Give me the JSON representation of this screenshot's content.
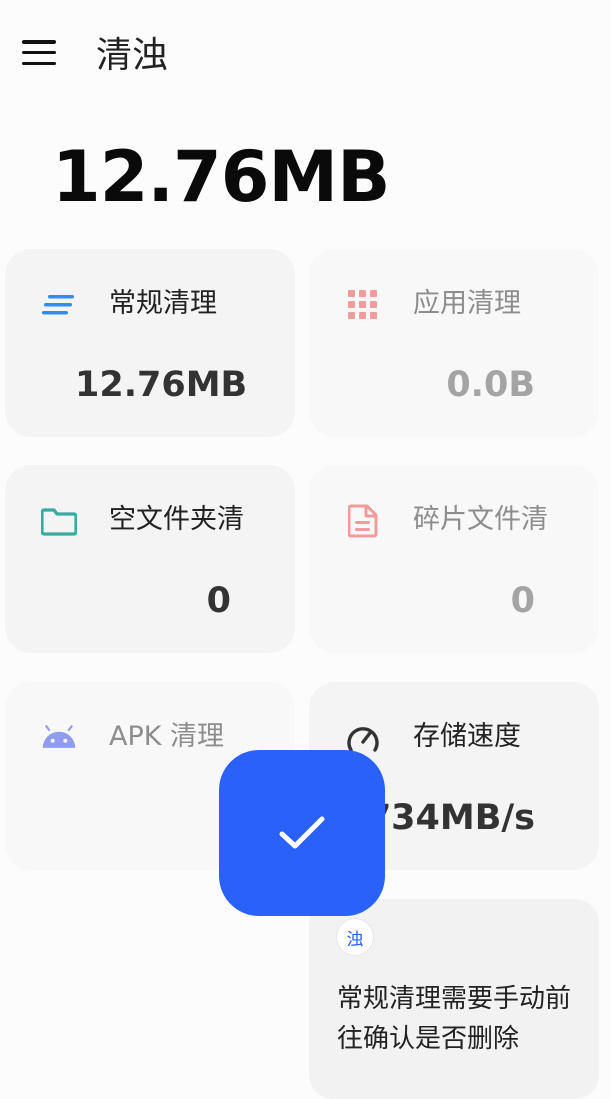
{
  "header": {
    "title": "清浊"
  },
  "summary": {
    "total_size": "12.76MB"
  },
  "cards": [
    {
      "id": "general",
      "label": "常规清理",
      "value": "12.76MB",
      "icon": "lines-icon",
      "icon_color": "#2f8cf0"
    },
    {
      "id": "app",
      "label": "应用清理",
      "value": "0.0B",
      "icon": "grid-icon",
      "icon_color": "#f19b9b"
    },
    {
      "id": "empty-folder",
      "label": "空文件夹清",
      "value": "0",
      "icon": "folder-icon",
      "icon_color": "#3aa99f"
    },
    {
      "id": "fragment",
      "label": "碎片文件清",
      "value": "0",
      "icon": "document-icon",
      "icon_color": "#f19b9b"
    },
    {
      "id": "apk",
      "label": "APK 清理",
      "value": "",
      "icon": "android-icon",
      "icon_color": "#8f9cf0"
    },
    {
      "id": "storage-speed",
      "label": "存储速度",
      "value": "734MB/s",
      "icon": "speedometer-icon",
      "icon_color": "#333333"
    }
  ],
  "fab": {
    "icon": "check-icon",
    "color": "#2a62f9"
  },
  "tip": {
    "avatar_text": "浊",
    "text": "常规清理需要手动前往确认是否删除"
  }
}
